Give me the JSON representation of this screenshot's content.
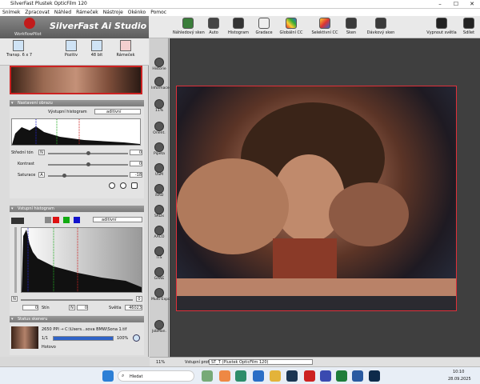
{
  "window": {
    "title": "SilverFast Plustek OpticFilm 120",
    "controls": [
      "–",
      "☐",
      "✕"
    ]
  },
  "menu": [
    "Snímek",
    "Zpracovat",
    "Náhled",
    "Rámeček",
    "Nástroje",
    "Okénko",
    "Pomoc"
  ],
  "brand": {
    "name": "SilverFast Ai Studio",
    "workflow": "WorkflowPilot"
  },
  "toolbar": {
    "buttons": [
      "Náhledový sken",
      "Auto",
      "Histogram",
      "Gradace",
      "Globální CC",
      "Selektivní CC",
      "Sken",
      "Dávkový sken"
    ],
    "right": [
      "Vypnout světla",
      "Sdílet"
    ]
  },
  "subtoolbar": [
    "Transp. 6 x 7",
    "Pozitiv",
    "48 bit",
    "Rámeček"
  ],
  "image_adjust": {
    "header": "Nastavení obrazu",
    "histogram_label": "Výstupní histogram",
    "histogram_mode": "aditivní",
    "rows": [
      {
        "label": "Střední tón",
        "key": "N",
        "value": "0"
      },
      {
        "label": "Kontrast",
        "key": "",
        "value": "0"
      },
      {
        "label": "Saturace",
        "key": "A",
        "value": "-18"
      }
    ]
  },
  "input_hist": {
    "header": "Vstupní histogram",
    "mode": "aditivní",
    "shadow_label": "Stín",
    "shadow_key": "N",
    "shadow_value": "0",
    "highlight_label": "Světla",
    "highlight_value": "46023",
    "corner_left": "N",
    "corner_right": "0"
  },
  "scanner": {
    "header": "Status skeneru",
    "job": "2650 PPI → C:\\Users...sova BMW\\Sona 1.tif",
    "counter": "1/1",
    "progress_text": "100%",
    "progress": 1.0,
    "status": "Hotovo"
  },
  "sidebar": [
    "Historie",
    "Informace",
    "11%",
    "Orient.",
    "Pipeta",
    "USM",
    "iSRD",
    "SRDx",
    "AACO",
    "ITS",
    "GANE",
    "Multi-Expo",
    "JobMan."
  ],
  "status": {
    "zoom": "11%",
    "profile_label": "Vstupní profil:",
    "profile": "ST_T (Plustek OpticFilm 120)"
  },
  "taskbar": {
    "search": "Hledat",
    "time": "10:10",
    "date": "28.09.2025"
  }
}
